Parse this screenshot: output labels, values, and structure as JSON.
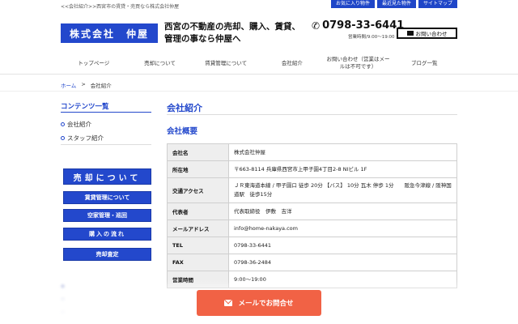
{
  "header": {
    "topnote": "<<会社紹介>>西宮市の賃貸・売買なら株式会社仲屋",
    "toplinks": [
      "お気に入り物件",
      "最近見た物件",
      "サイトマップ"
    ],
    "logo": "株式会社　仲屋",
    "catchcopy": "西宮の不動産の売却、購入、賃貸、管理の事なら仲屋へ",
    "tel": "0798-33-6441",
    "hours": "営業時間/9:00〜19:00",
    "contact_button": "お問い合わせ"
  },
  "nav": [
    "トップページ",
    "売却について",
    "賃貸管理について",
    "会社紹介",
    "お問い合わせ（営業はメールは不可です）",
    "ブログ一覧"
  ],
  "breadcrumb": {
    "home": "ホーム",
    "sep": ">",
    "current": "会社紹介"
  },
  "sidebar": {
    "title": "コンテンツ一覧",
    "items": [
      "会社紹介",
      "スタッフ紹介"
    ],
    "buttons": [
      "売却について",
      "賃貸管理について",
      "空家管理・巡回",
      "購入の流れ",
      "売却査定"
    ]
  },
  "main": {
    "title": "会社紹介",
    "subtitle": "会社概要",
    "rows": [
      {
        "label": "会社名",
        "value": "株式会社仲屋"
      },
      {
        "label": "所在地",
        "value": "〒663-8114 兵庫県西宮市上甲子園4丁目2-8 NIビル 1F"
      },
      {
        "label": "交通アクセス",
        "value": "ＪＲ東海道本線 / 甲子園口 徒歩 20分 【バス】 10分 瓦木 停歩 1分　　阪急今津線 / 阪神国道駅　徒歩15分"
      },
      {
        "label": "代表者",
        "value": "代表取締役　伊敷　吉洋"
      },
      {
        "label": "メールアドレス",
        "value": "info@home-nakaya.com"
      },
      {
        "label": "TEL",
        "value": "0798-33-6441"
      },
      {
        "label": "FAX",
        "value": "0798-36-2484"
      },
      {
        "label": "営業時間",
        "value": "9:00〜19:00"
      }
    ]
  },
  "float_button": "メールでお問合せ",
  "colors": {
    "brand": "#2348cc",
    "cta": "#f16245"
  }
}
